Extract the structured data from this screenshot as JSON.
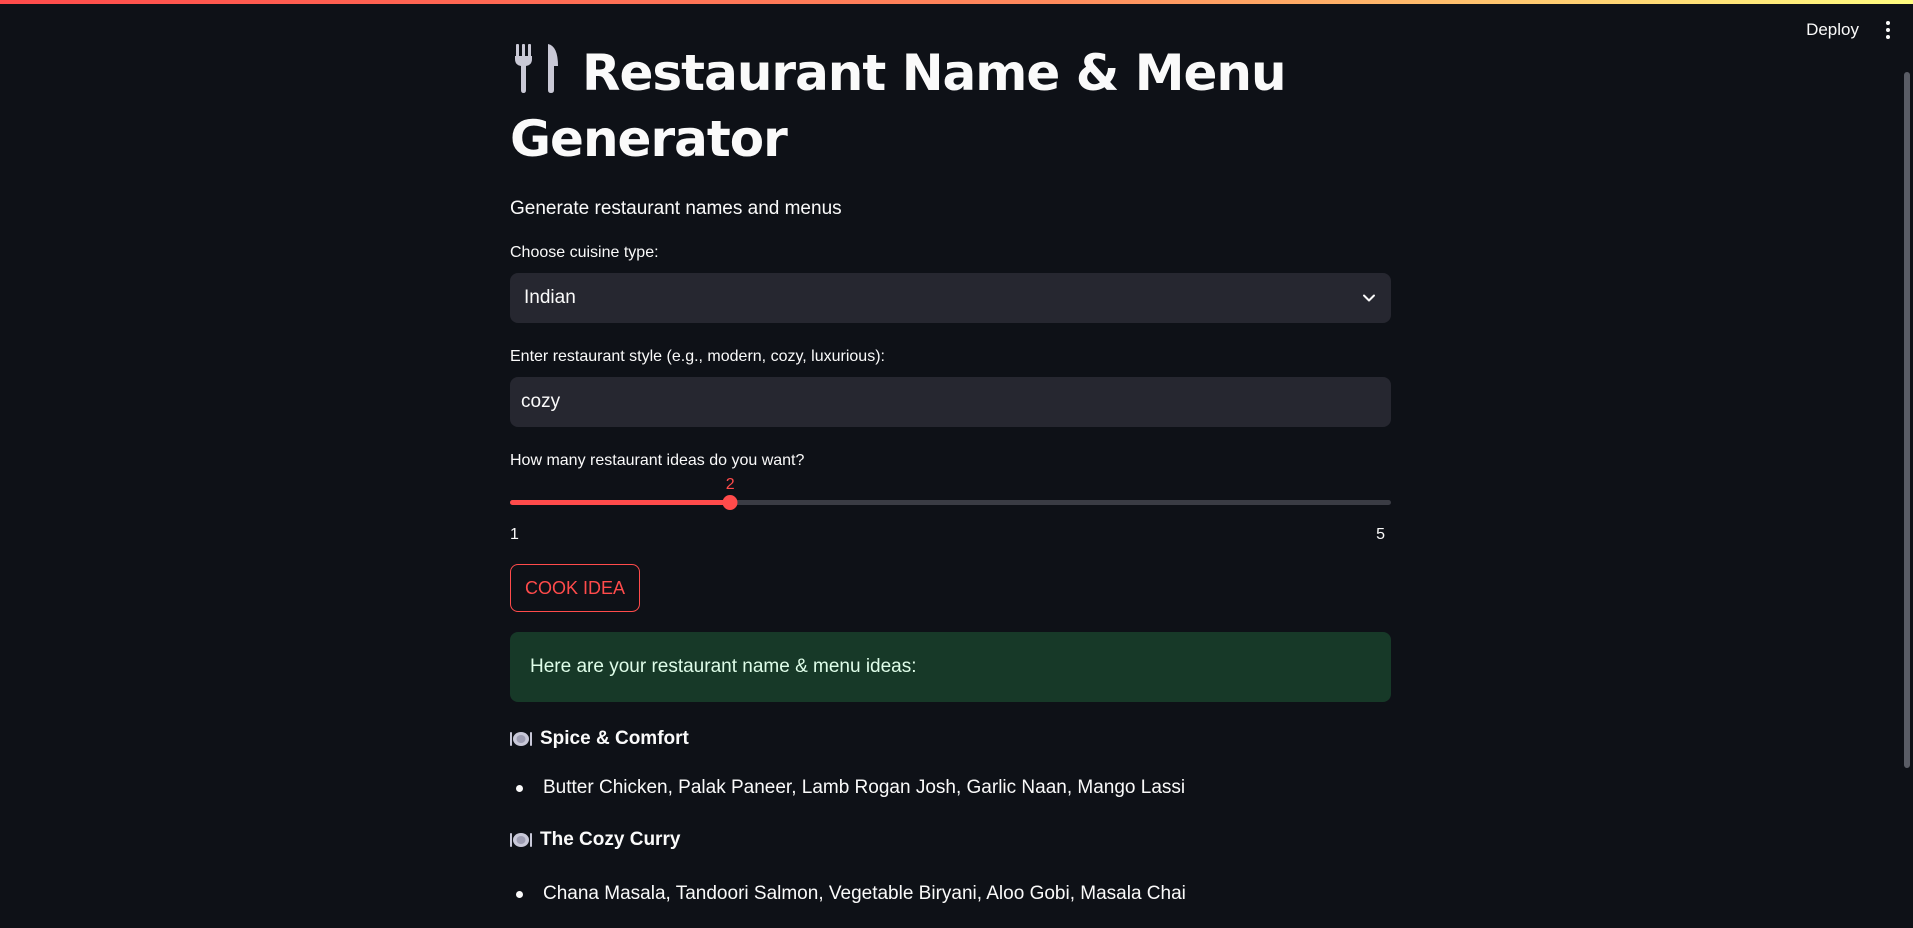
{
  "header": {
    "deploy_label": "Deploy"
  },
  "page": {
    "title_icon": "fork-and-knife-icon",
    "title": "Restaurant Name & Menu Generator",
    "subtitle": "Generate restaurant names and menus"
  },
  "cuisine": {
    "label": "Choose cuisine type:",
    "value": "Indian"
  },
  "style": {
    "label": "Enter restaurant style (e.g., modern, cozy, luxurious):",
    "value": "cozy"
  },
  "count": {
    "label": "How many restaurant ideas do you want?",
    "value": 2,
    "value_text": "2",
    "min": 1,
    "max": 5,
    "min_text": "1",
    "max_text": "5"
  },
  "button": {
    "label": "COOK IDEA"
  },
  "result": {
    "message": "Here are your restaurant name & menu ideas:",
    "ideas": [
      {
        "name": "Spice & Comfort",
        "menu": "Butter Chicken, Palak Paneer, Lamb Rogan Josh, Garlic Naan, Mango Lassi"
      },
      {
        "name": "The Cozy Curry",
        "menu": "Chana Masala, Tandoori Salmon, Vegetable Biryani, Aloo Gobi, Masala Chai"
      }
    ]
  },
  "colors": {
    "background": "#0e1117",
    "accent": "#ff4b4b",
    "input_bg": "#262730",
    "success_bg": "#173928"
  }
}
